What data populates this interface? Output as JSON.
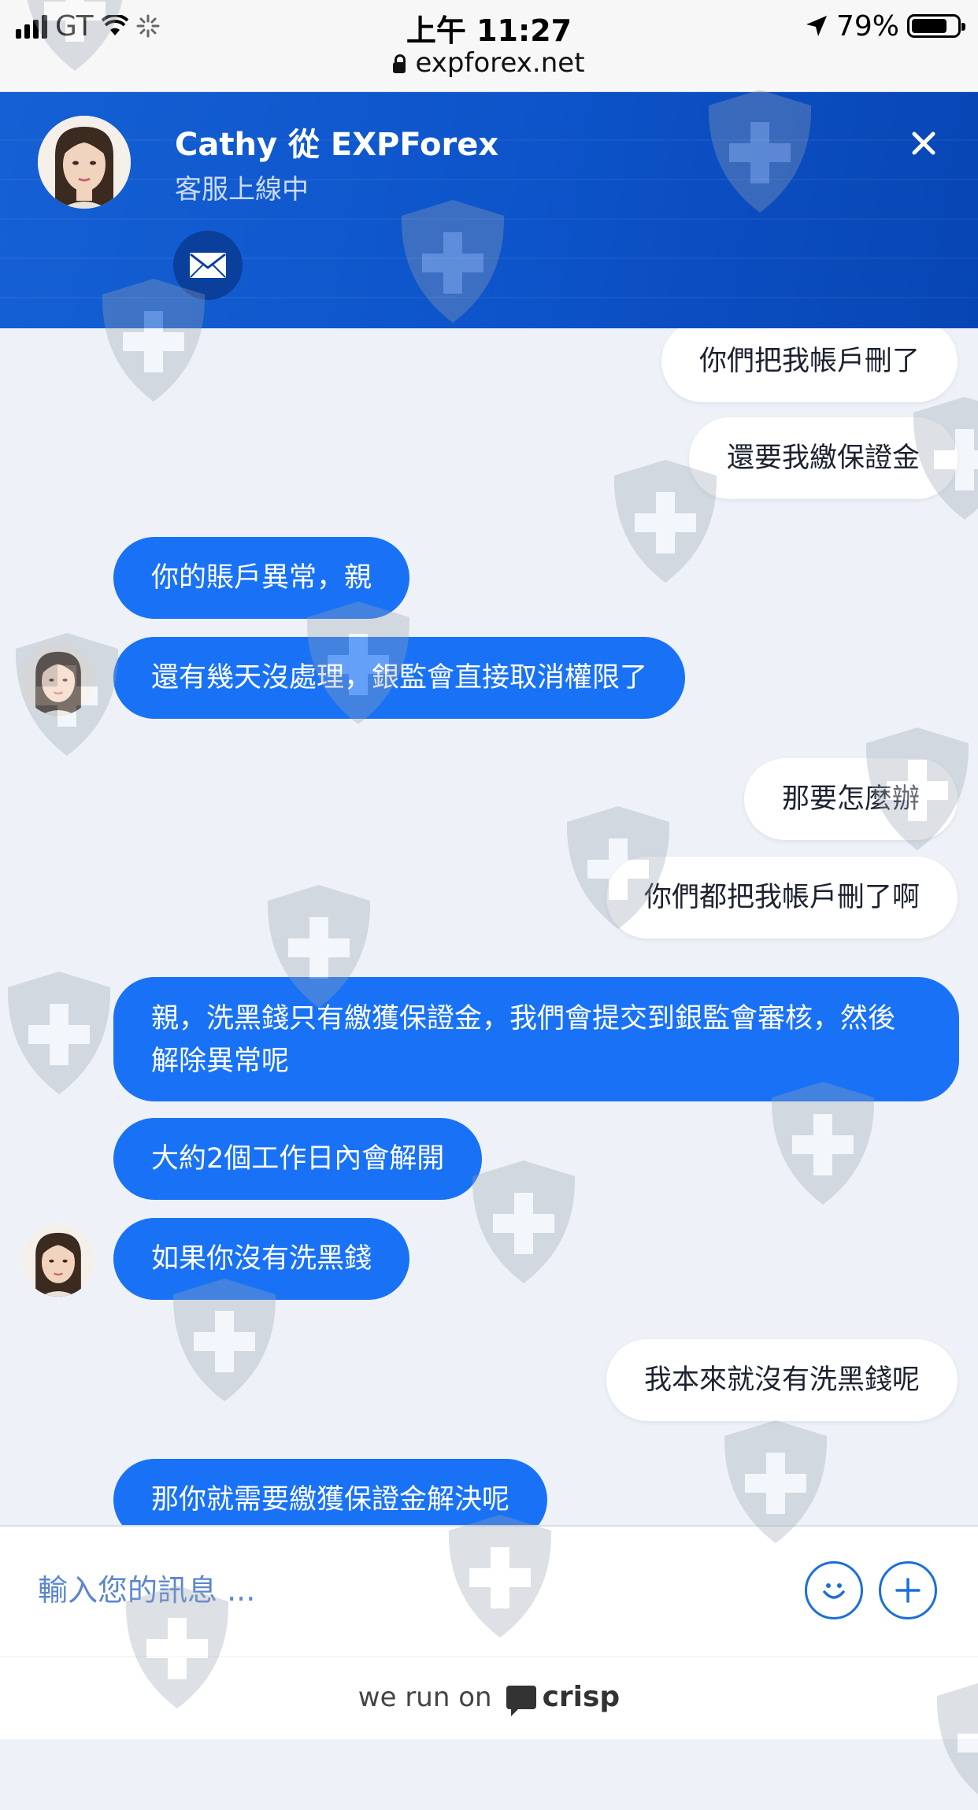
{
  "status_bar": {
    "carrier": "GT",
    "time": "上午 11:27",
    "battery": "79%",
    "battery_level": 0.79,
    "url": "expforex.net"
  },
  "header": {
    "agent_name": "Cathy 從 EXPForex",
    "agent_status": "客服上線中"
  },
  "messages": [
    {
      "dir": "out",
      "text": "你們把我帳戶刪了"
    },
    {
      "dir": "out",
      "text": "還要我繳保證金"
    },
    {
      "dir": "in",
      "text": "你的賬戶異常，親"
    },
    {
      "dir": "in",
      "text": "還有幾天沒處理，銀監會直接取消權限了"
    },
    {
      "dir": "out",
      "text": "那要怎麼辦"
    },
    {
      "dir": "out",
      "text": "你們都把我帳戶刪了啊"
    },
    {
      "dir": "in",
      "text": "親，洗黑錢只有繳獲保證金，我們會提交到銀監會審核，然後解除異常呢"
    },
    {
      "dir": "in",
      "text": "大約2個工作日內會解開"
    },
    {
      "dir": "in",
      "text": "如果你沒有洗黑錢"
    },
    {
      "dir": "out",
      "text": "我本來就沒有洗黑錢呢"
    },
    {
      "dir": "in",
      "text": "那你就需要繳獲保證金解決呢"
    }
  ],
  "composer": {
    "placeholder": "輸入您的訊息 ..."
  },
  "footer": {
    "prefix": "we run on",
    "brand": "crisp"
  },
  "colors": {
    "header_blue": "#0d53c9",
    "bubble_blue": "#1972f5",
    "accent": "#1a6fd9"
  }
}
